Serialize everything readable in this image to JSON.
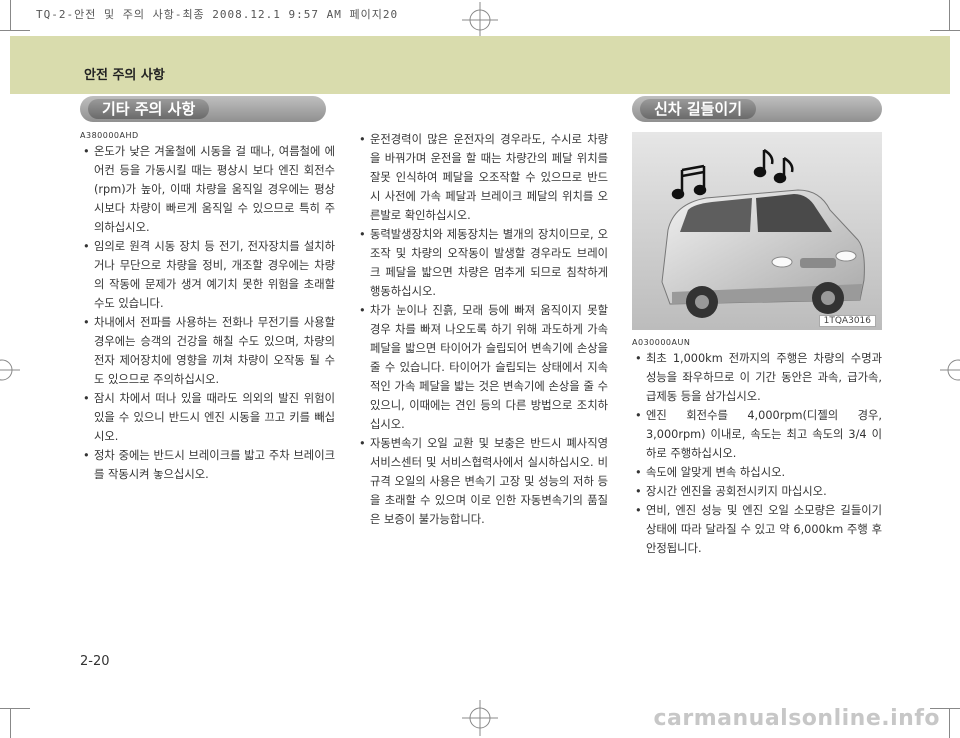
{
  "print_header": "TQ-2-안전 및 주의 사항-최종  2008.12.1 9:57 AM 페이지20",
  "section_title": "안전 주의 사항",
  "left": {
    "heading": "기타 주의 사항",
    "code": "A380000AHD",
    "items": [
      "온도가 낮은 겨울철에 시동을 걸 때나, 여름철에 에어컨 등을 가동시킬 때는 평상시 보다 엔진 회전수(rpm)가 높아, 이때 차량을 움직일 경우에는 평상시보다 차량이 빠르게 움직일 수 있으므로 특히 주의하십시오.",
      "임의로 원격 시동 장치 등 전기, 전자장치를 설치하거나 무단으로 차량을 정비, 개조할 경우에는 차량의 작동에 문제가 생겨 예기치 못한 위험을 초래할 수도 있습니다.",
      "차내에서 전파를 사용하는 전화나 무전기를 사용할 경우에는 승객의 건강을 해칠 수도 있으며, 차량의 전자 제어장치에 영향을 끼쳐 차량이 오작동 될 수도 있으므로 주의하십시오.",
      "잠시 차에서 떠나 있을 때라도 의외의 발진 위험이 있을 수 있으니 반드시 엔진 시동을 끄고 키를 빼십시오.",
      "정차 중에는 반드시 브레이크를 밟고 주차 브레이크를 작동시켜 놓으십시오."
    ]
  },
  "middle": {
    "items": [
      "운전경력이 많은 운전자의 경우라도, 수시로 차량을 바꿔가며 운전을 할 때는 차량간의 페달 위치를 잘못 인식하여 페달을 오조작할 수 있으므로 반드시 사전에 가속 페달과 브레이크 페달의 위치를 오른발로 확인하십시오.",
      "동력발생장치와 제동장치는 별개의 장치이므로, 오조작 및 차량의 오작동이 발생할 경우라도 브레이크 페달을 밟으면 차량은 멈추게 되므로 침착하게 행동하십시오.",
      "차가 눈이나 진흙, 모래 등에 빠져 움직이지 못할 경우 차를 빠져 나오도록 하기 위해 과도하게 가속 페달을 밟으면 타이어가 슬립되어 변속기에 손상을 줄 수 있습니다. 타이어가 슬립되는 상태에서 지속적인 가속 페달을 밟는 것은 변속기에 손상을 줄 수 있으니, 이때에는 견인 등의 다른 방법으로 조치하십시오.",
      "자동변속기 오일 교환 및 보충은 반드시 폐사직영 서비스센터 및 서비스협력사에서 실시하십시오. 비규격 오일의 사용은 변속기 고장 및 성능의 저하 등을 초래할 수 있으며 이로 인한 자동변속기의 품질은 보증이 불가능합니다."
    ]
  },
  "right": {
    "heading": "신차 길들이기",
    "image_id": "1TQA3016",
    "code": "A030000AUN",
    "items": [
      "최초 1,000km 전까지의 주행은 차량의 수명과 성능을 좌우하므로 이 기간 동안은 과속, 급가속, 급제동 등을 삼가십시오.",
      "엔진 회전수를 4,000rpm(디젤의 경우, 3,000rpm) 이내로, 속도는 최고 속도의 3/4 이하로 주행하십시오.",
      "속도에 알맞게 변속 하십시오.",
      "장시간 엔진을 공회전시키지 마십시오.",
      "연비, 엔진 성능 및 엔진 오일 소모량은 길들이기 상태에 따라 달라질 수 있고 약 6,000km 주행 후 안정됩니다."
    ]
  },
  "page_number": "2-20",
  "watermark": "carmanualsonline.info"
}
